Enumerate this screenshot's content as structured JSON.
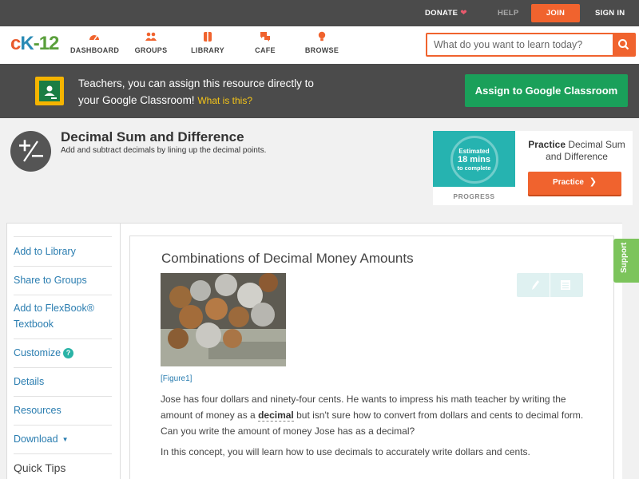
{
  "topbar": {
    "donate": "DONATE",
    "help": "HELP",
    "join": "JOIN",
    "signin": "SIGN IN"
  },
  "nav": {
    "logo": {
      "c": "c",
      "k": "K",
      "rest": "-12"
    },
    "items": [
      {
        "label": "DASHBOARD",
        "icon": "dashboard-icon"
      },
      {
        "label": "GROUPS",
        "icon": "groups-icon"
      },
      {
        "label": "LIBRARY",
        "icon": "library-icon"
      },
      {
        "label": "CAFE",
        "icon": "cafe-icon"
      },
      {
        "label": "BROWSE",
        "icon": "browse-icon"
      }
    ],
    "search_placeholder": "What do you want to learn today?"
  },
  "banner": {
    "text_line1": "Teachers, you can assign this resource directly to",
    "text_line2": "your Google Classroom!",
    "what_link": "What is this?",
    "assign_button": "Assign to Google Classroom"
  },
  "concept": {
    "title": "Decimal Sum and Difference",
    "subtitle": "Add and subtract decimals by lining up the decimal points."
  },
  "practice": {
    "estimated": "Estimated",
    "minutes": "18 mins",
    "to_complete": "to complete",
    "progress_label": "PROGRESS",
    "title_bold": "Practice",
    "title_rest": "Decimal Sum and Difference",
    "button": "Practice"
  },
  "sidebar": {
    "items": [
      {
        "label": "Add to Library"
      },
      {
        "label": "Share to Groups"
      },
      {
        "label": "Add to FlexBook® Textbook"
      },
      {
        "label": "Customize"
      },
      {
        "label": "Details"
      },
      {
        "label": "Resources"
      },
      {
        "label": "Download"
      }
    ],
    "quick_tips": "Quick Tips"
  },
  "article": {
    "title": "Combinations of Decimal Money Amounts",
    "figure_label": "[Figure1]",
    "para1_a": "Jose has four dollars and ninety-four cents. He wants to impress his math teacher by writing the amount of money as a",
    "para1_kw": "decimal",
    "para1_b": "but isn't sure how to convert from dollars and cents to decimal form. Can you write the amount of money Jose has as a decimal?",
    "para2": "In this concept, you will learn how to use decimals to accurately write dollars and cents."
  },
  "support": "Support",
  "colors": {
    "accent_orange": "#f0632e",
    "dark_bar": "#4b4b4b",
    "assign_green": "#1aa05a",
    "link_blue": "#2a7db0",
    "support_green": "#7cc45b",
    "practice_teal": "#26b3b0"
  }
}
